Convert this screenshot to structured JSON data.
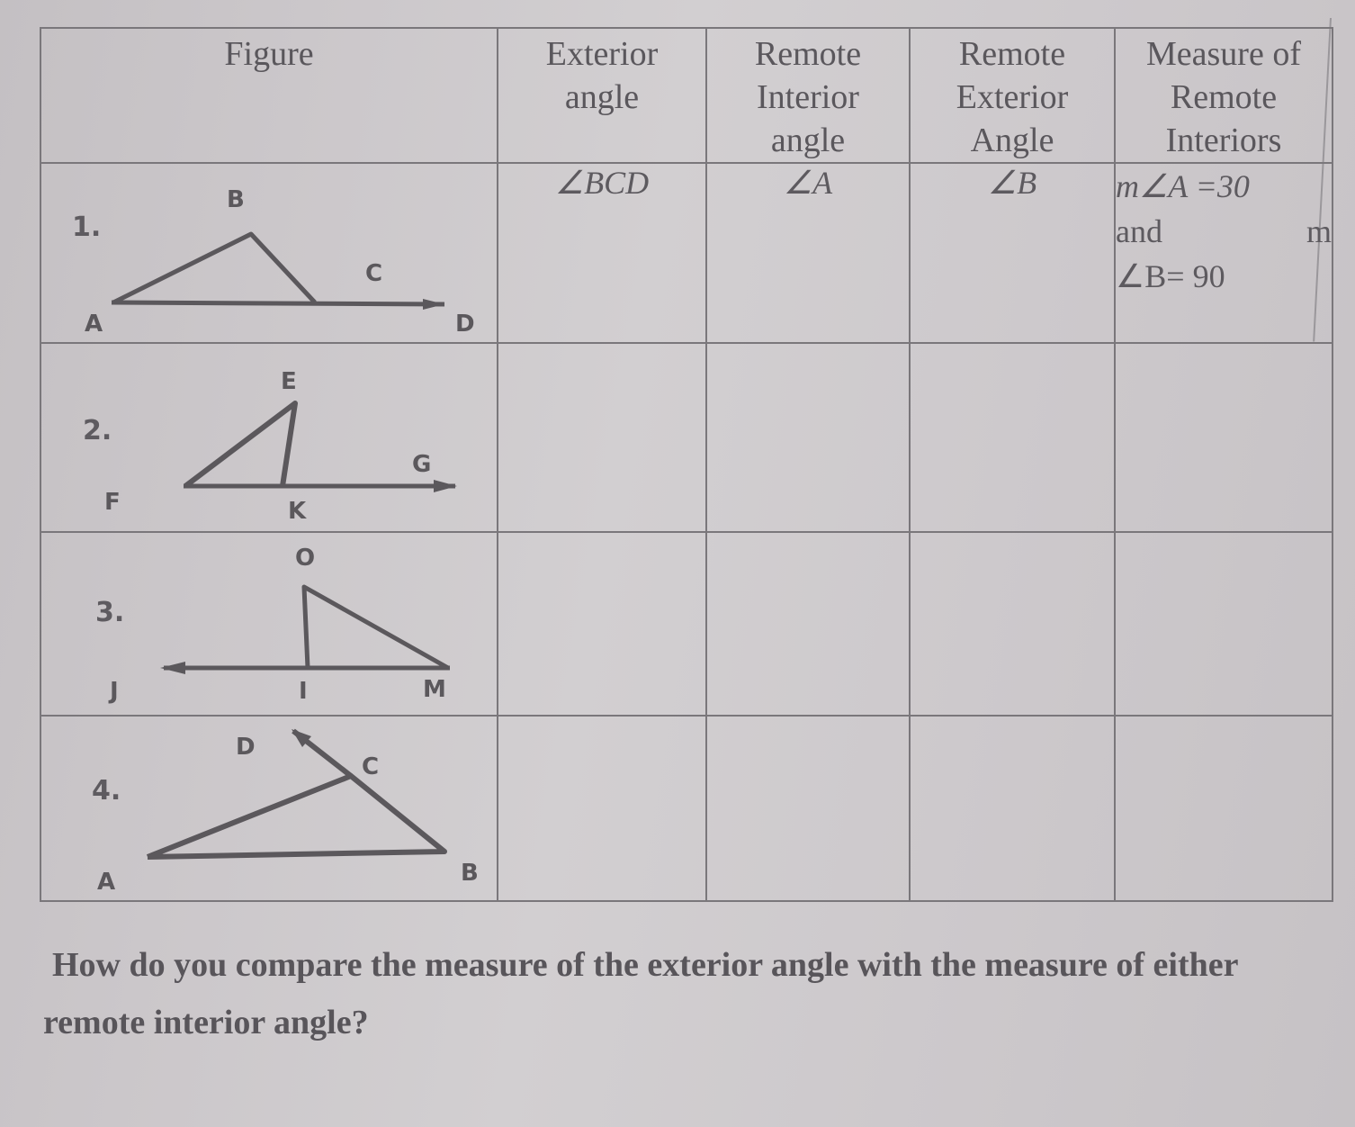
{
  "worksheet": {
    "headers": [
      "Figure",
      "Exterior\nangle",
      "Remote\nInterior\nangle",
      "Remote\nExterior\nAngle",
      "Measure of\nRemote\nInteriors"
    ],
    "rows": [
      {
        "number": "1.",
        "figure_labels": {
          "B": "B",
          "C": "C",
          "A": "A",
          "D": "D"
        },
        "exterior_angle": "∠BCD",
        "remote_interior_angle": "∠A",
        "remote_exterior_angle": "∠B",
        "measure": {
          "line1": "m∠A =30",
          "line2_left": "and",
          "line2_right": "m",
          "line3": "∠B= 90"
        }
      },
      {
        "number": "2.",
        "figure_labels": {
          "E": "E",
          "F": "F",
          "K": "K",
          "G": "G"
        },
        "exterior_angle": "",
        "remote_interior_angle": "",
        "remote_exterior_angle": "",
        "measure": null
      },
      {
        "number": "3.",
        "figure_labels": {
          "O": "O",
          "J": "J",
          "I": "I",
          "M": "M"
        },
        "exterior_angle": "",
        "remote_interior_angle": "",
        "remote_exterior_angle": "",
        "measure": null
      },
      {
        "number": "4.",
        "figure_labels": {
          "D": "D",
          "C": "C",
          "A": "A",
          "B": "B"
        },
        "exterior_angle": "",
        "remote_interior_angle": "",
        "remote_exterior_angle": "",
        "measure": null
      }
    ]
  },
  "question": "How do you compare the measure of the exterior angle with the measure of either remote interior angle?"
}
